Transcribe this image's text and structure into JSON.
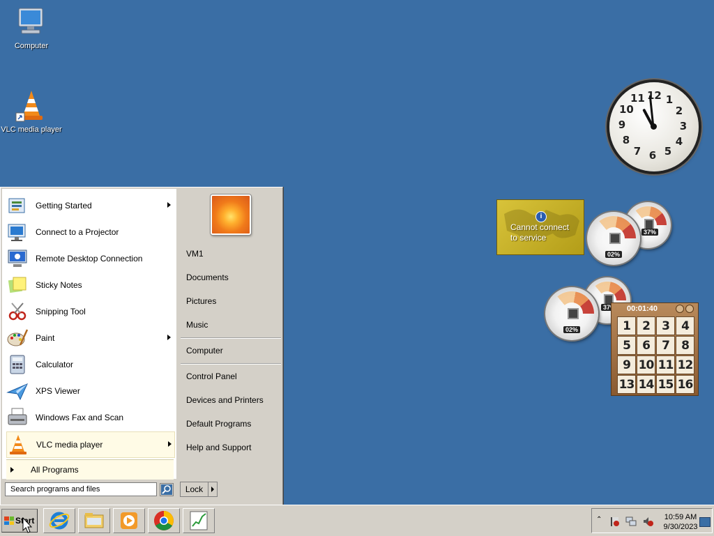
{
  "desktop": {
    "icons": [
      {
        "label": "Computer",
        "icon": "computer-icon"
      },
      {
        "label": "VLC media player",
        "icon": "vlc-cone-icon"
      }
    ]
  },
  "gadgets": {
    "clock": {
      "numbers": [
        "12",
        "1",
        "2",
        "3",
        "4",
        "5",
        "6",
        "7",
        "8",
        "9",
        "10",
        "11"
      ],
      "time": "10:59"
    },
    "weather": {
      "message_line1": "Cannot connect",
      "message_line2": "to service"
    },
    "cpu_meter_1": {
      "cpu": "02%",
      "memory": "37%"
    },
    "cpu_meter_2": {
      "cpu": "02%",
      "memory": "37%"
    },
    "puzzle": {
      "timer": "00:01:40",
      "tiles": [
        "1",
        "2",
        "3",
        "4",
        "5",
        "6",
        "7",
        "8",
        "9",
        "10",
        "11",
        "12",
        "13",
        "14",
        "15",
        "16"
      ]
    }
  },
  "start_menu": {
    "programs": [
      {
        "label": "Getting Started",
        "icon": "getting-started-icon",
        "submenu": true
      },
      {
        "label": "Connect to a Projector",
        "icon": "projector-icon",
        "submenu": false
      },
      {
        "label": "Remote Desktop Connection",
        "icon": "remote-desktop-icon",
        "submenu": false
      },
      {
        "label": "Sticky Notes",
        "icon": "sticky-notes-icon",
        "submenu": false
      },
      {
        "label": "Snipping Tool",
        "icon": "snipping-tool-icon",
        "submenu": false
      },
      {
        "label": "Paint",
        "icon": "paint-icon",
        "submenu": true
      },
      {
        "label": "Calculator",
        "icon": "calculator-icon",
        "submenu": false
      },
      {
        "label": "XPS Viewer",
        "icon": "xps-viewer-icon",
        "submenu": false
      },
      {
        "label": "Windows Fax and Scan",
        "icon": "fax-scan-icon",
        "submenu": false
      },
      {
        "label": "VLC media player",
        "icon": "vlc-cone-icon",
        "submenu": true
      }
    ],
    "all_programs": "All Programs",
    "search_placeholder": "Search programs and files",
    "right": {
      "user": "VM1",
      "documents": "Documents",
      "pictures": "Pictures",
      "music": "Music",
      "computer": "Computer",
      "control_panel": "Control Panel",
      "devices_printers": "Devices and Printers",
      "default_programs": "Default Programs",
      "help_support": "Help and Support"
    },
    "lock_label": "Lock"
  },
  "taskbar": {
    "start_label": "Start",
    "apps": [
      {
        "name": "Internet Explorer",
        "icon": "internet-explorer-icon"
      },
      {
        "name": "Windows Explorer",
        "icon": "folder-icon"
      },
      {
        "name": "Windows Media Player",
        "icon": "media-player-icon"
      },
      {
        "name": "Google Chrome",
        "icon": "chrome-icon"
      },
      {
        "name": "Performance chart",
        "icon": "chart-icon"
      }
    ],
    "clock_time": "10:59 AM",
    "clock_date": "9/30/2023"
  },
  "colors": {
    "desktop": "#3a6ea5",
    "menu_bg": "#d4d0c8",
    "highlight": "#fffbe6"
  }
}
